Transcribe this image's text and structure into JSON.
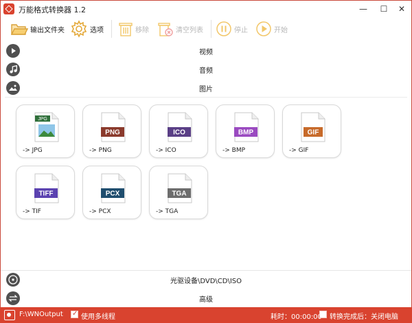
{
  "window": {
    "title": "万能格式转换器 1.2",
    "minimize_glyph": "—",
    "maximize_glyph": "☐",
    "close_glyph": "✕"
  },
  "toolbar": {
    "output_folder_label": "输出文件夹",
    "options_label": "选项",
    "remove_label": "移除",
    "clear_list_label": "清空列表",
    "stop_label": "停止",
    "start_label": "开始"
  },
  "categories": {
    "video": "视频",
    "audio": "音频",
    "image": "图片",
    "disc": "光驱设备\\DVD\\CD\\ISO",
    "advanced": "高级"
  },
  "formats": [
    {
      "badge": "JPG",
      "label": "-> JPG",
      "color": "#2f6f3a"
    },
    {
      "badge": "PNG",
      "label": "-> PNG",
      "color": "#8a3a2c"
    },
    {
      "badge": "ICO",
      "label": "-> ICO",
      "color": "#5a3f86"
    },
    {
      "badge": "BMP",
      "label": "-> BMP",
      "color": "#9a4ac0"
    },
    {
      "badge": "GIF",
      "label": "-> GIF",
      "color": "#c76a2a"
    },
    {
      "badge": "TIFF",
      "label": "-> TIF",
      "color": "#5b42b0"
    },
    {
      "badge": "PCX",
      "label": "-> PCX",
      "color": "#1f4d6e"
    },
    {
      "badge": "TGA",
      "label": "-> TGA",
      "color": "#6d6d6d"
    }
  ],
  "status": {
    "output_path": "F:\\WNOutput",
    "multithread_label": "使用多线程",
    "multithread_checked": true,
    "elapsed": "耗时：00:00:00",
    "after_done_label": "转换完成后：关闭电脑",
    "after_done_checked": false
  },
  "colors": {
    "accent": "#d9432f",
    "disabled": "#f2c76a"
  }
}
